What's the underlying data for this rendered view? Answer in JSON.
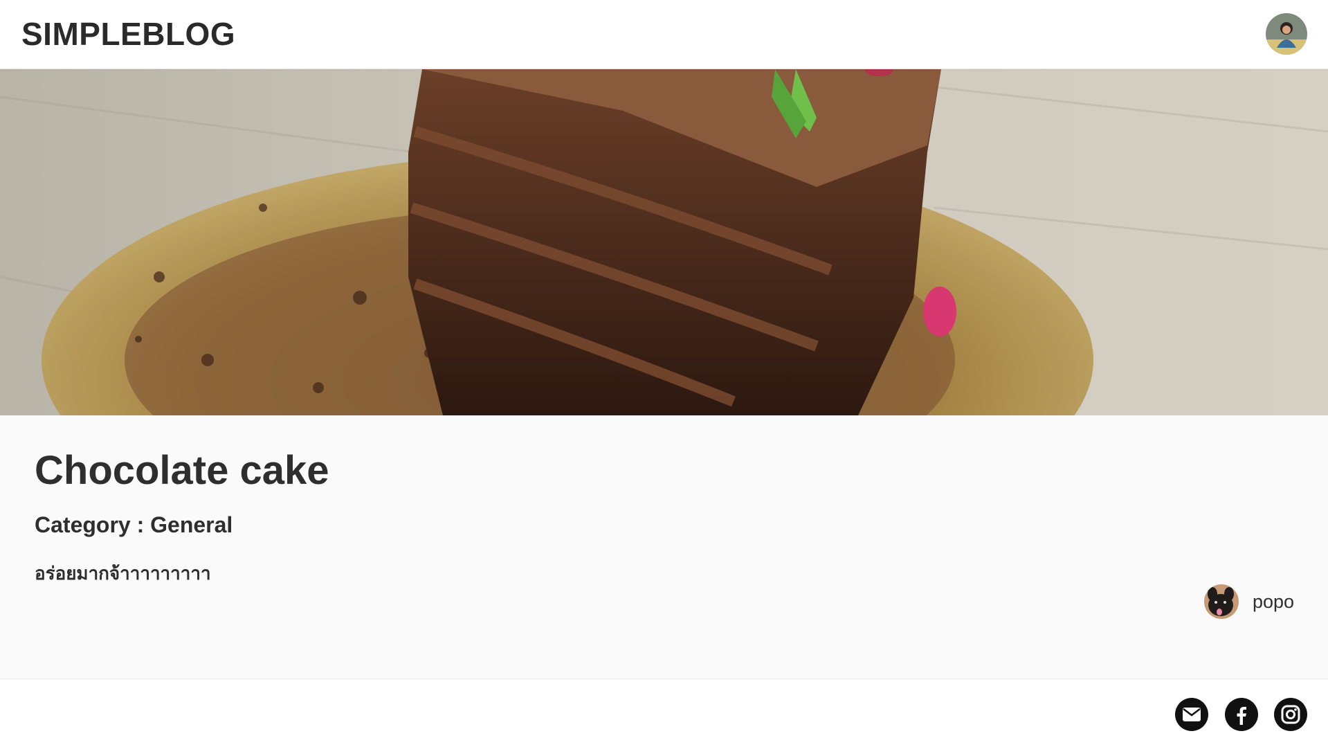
{
  "header": {
    "brand": "SIMPLEBLOG",
    "user_avatar_icon": "user-avatar-icon"
  },
  "post": {
    "cover_image": "chocolate-cake-photo",
    "title": "Chocolate cake",
    "category": "Category : General",
    "body": "อร่อยมากจ้าาาาาาาาา",
    "author": {
      "name": "popo",
      "avatar_icon": "dog-avatar-icon"
    }
  },
  "footer": {
    "social": [
      {
        "name": "email",
        "icon": "mail-icon"
      },
      {
        "name": "facebook",
        "icon": "facebook-icon"
      },
      {
        "name": "instagram",
        "icon": "instagram-icon"
      }
    ]
  },
  "colors": {
    "header_bg": "#ffffff",
    "page_bg": "#fafafa",
    "text": "#2e2e2e",
    "social_icon_bg": "#111111"
  }
}
